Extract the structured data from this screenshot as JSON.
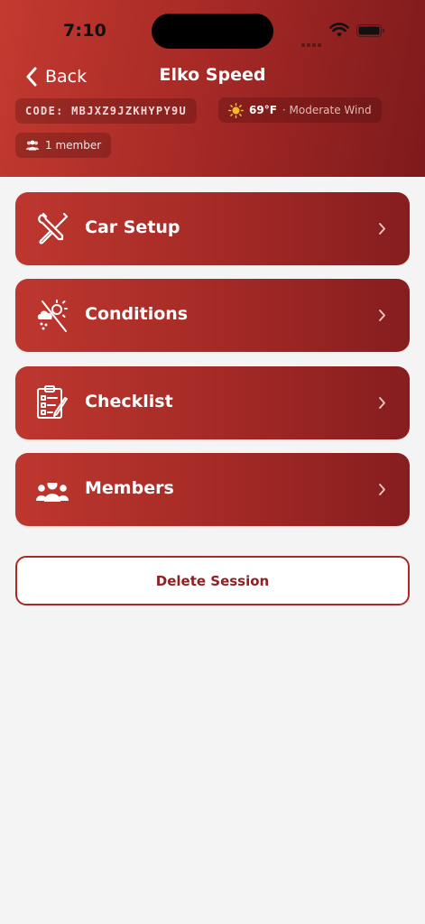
{
  "status_bar": {
    "time": "7:10"
  },
  "nav": {
    "back_label": "Back",
    "title": "Elko Speed"
  },
  "session": {
    "code": "CODE: MBJXZ9JZKHYPY9U",
    "temperature": "69°F",
    "wind": "· Moderate Wind",
    "members": "1 member"
  },
  "menu": [
    {
      "label": "Car Setup",
      "icon": "wrench-screwdriver-icon"
    },
    {
      "label": "Conditions",
      "icon": "weather-icon"
    },
    {
      "label": "Checklist",
      "icon": "clipboard-checklist-icon"
    },
    {
      "label": "Members",
      "icon": "people-group-icon"
    }
  ],
  "actions": {
    "delete_label": "Delete Session"
  },
  "colors": {
    "accent": "#a82a26",
    "accent_dark": "#7e1a1c",
    "background": "#f4f4f4"
  }
}
